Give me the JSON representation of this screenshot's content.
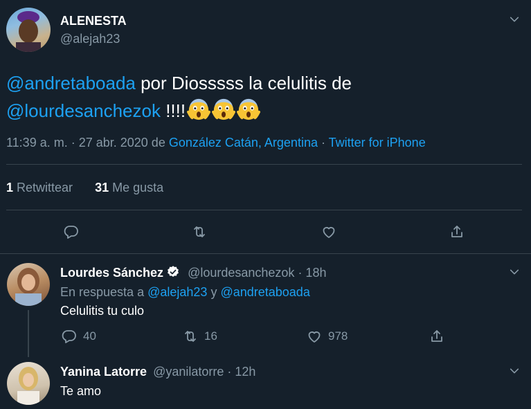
{
  "tweet": {
    "author_name": "ALENESTA",
    "author_handle": "@alejah23",
    "text_mention1": "@andretaboada",
    "text_part1": " por Diosssss la celulitis de",
    "text_mention2": "@lourdesanchezok",
    "text_part2": " !!!!",
    "emoji_count": 3,
    "time": "11:39 a. m. · 27 abr. 2020 de ",
    "location": "González Catán, Argentina",
    "separator": " · ",
    "source": "Twitter for iPhone",
    "retweets_count": "1",
    "retweets_label": " Retwittear",
    "likes_count": "31",
    "likes_label": " Me gusta"
  },
  "replies": [
    {
      "name": "Lourdes Sánchez",
      "handle": "@lourdesanchezok",
      "age": " · 18h",
      "reply_prefix": "En respuesta a ",
      "reply_to1": "@alejah23",
      "reply_and": " y ",
      "reply_to2": "@andretaboada",
      "text": "Celulitis tu culo",
      "replies": "40",
      "retweets": "16",
      "likes": "978"
    },
    {
      "name": "Yanina Latorre",
      "handle": "@yanilatorre",
      "age": " · 12h",
      "text": "Te amo"
    }
  ],
  "colors": {
    "background": "#15202b",
    "accent": "#1da1f2",
    "muted": "#8899a6",
    "divider": "#38444d"
  }
}
